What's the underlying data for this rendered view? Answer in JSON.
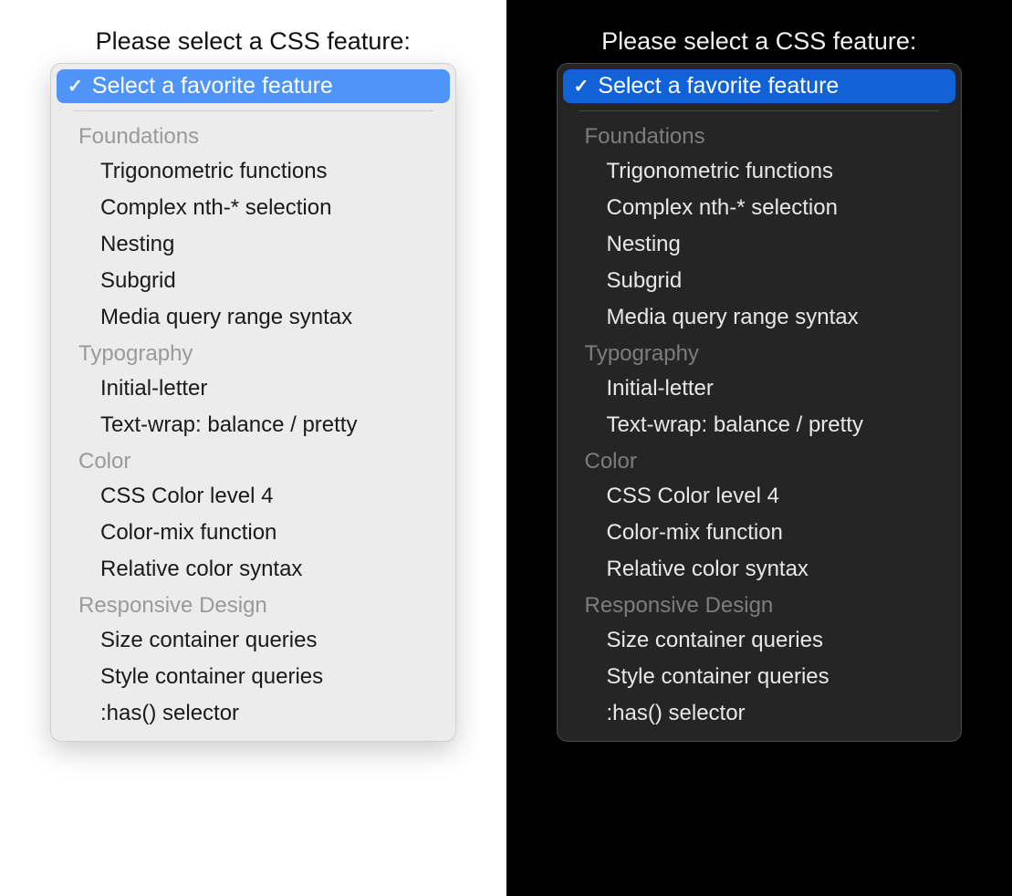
{
  "prompt": "Please select a CSS feature:",
  "selected_label": "Select a favorite feature",
  "colors": {
    "light_highlight": "#4f95f7",
    "dark_highlight": "#1062d6"
  },
  "groups": [
    {
      "label": "Foundations",
      "options": [
        "Trigonometric functions",
        "Complex nth-* selection",
        "Nesting",
        "Subgrid",
        "Media query range syntax"
      ]
    },
    {
      "label": "Typography",
      "options": [
        "Initial-letter",
        "Text-wrap: balance / pretty"
      ]
    },
    {
      "label": "Color",
      "options": [
        "CSS Color level 4",
        "Color-mix function",
        "Relative color syntax"
      ]
    },
    {
      "label": "Responsive Design",
      "options": [
        "Size container queries",
        "Style container queries",
        ":has() selector"
      ]
    }
  ]
}
